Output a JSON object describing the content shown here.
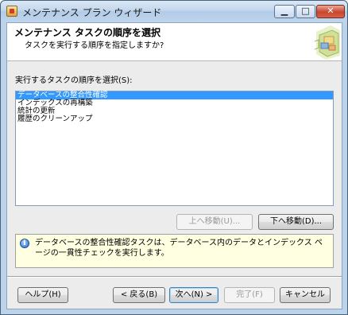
{
  "window": {
    "title": "メンテナンス プラン ウィザード",
    "minimize_glyph": "▁",
    "maximize_glyph": "□",
    "close_glyph": "✕"
  },
  "header": {
    "title": "メンテナンス タスクの順序を選択",
    "subtitle": "タスクを実行する順序を指定しますか?"
  },
  "list": {
    "label": "実行するタスクの順序を選択(S):",
    "items": [
      {
        "label": "データベースの整合性確認",
        "selected": true
      },
      {
        "label": "インデックスの再構築",
        "selected": false
      },
      {
        "label": "統計の更新",
        "selected": false
      },
      {
        "label": "履歴のクリーンアップ",
        "selected": false
      }
    ]
  },
  "order_buttons": {
    "move_up": "上へ移動(U)...",
    "move_down": "下へ移動(D)..."
  },
  "info": {
    "icon": "info-icon",
    "text": "データベースの整合性確認タスクは、データベース内のデータとインデックス ページの一貫性チェックを実行します。"
  },
  "footer": {
    "help": "ヘルプ(H)",
    "back": "< 戻る(B)",
    "next": "次へ(N) >",
    "finish": "完了(F)",
    "cancel": "キャンセル"
  },
  "colors": {
    "selection": "#3399ff",
    "info_background": "#ffffe1",
    "title_bar": "#c3d7ec"
  }
}
